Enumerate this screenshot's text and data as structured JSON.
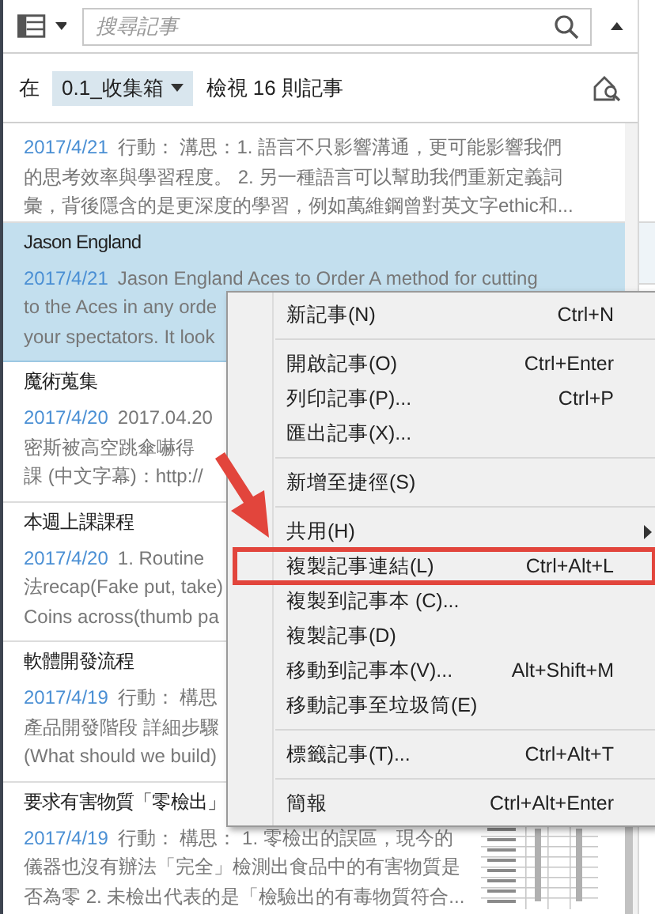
{
  "search": {
    "placeholder": "搜尋記事"
  },
  "filter": {
    "prefix": "在",
    "notebook": "0.1_收集箱",
    "count": "檢視 16 則記事"
  },
  "notes": [
    {
      "selected": false,
      "date": "2017/4/21",
      "lines": [
        "行動： 溝思：1. 語言不只影響溝通，更可能影響我們",
        "的思考效率與學習程度。 2. 另一種語言可以幫助我們重新定義詞",
        "彙，背後隱含的是更深度的學習，例如萬維鋼曾對英文字ethic和..."
      ]
    },
    {
      "selected": true,
      "title": "Jason England",
      "date": "2017/4/21",
      "lines": [
        "Jason England Aces to Order A method for cutting",
        "to the Aces in any orde",
        "your spectators. It look"
      ]
    },
    {
      "selected": false,
      "title": "魔術蒐集",
      "date": "2017/4/20",
      "lines": [
        "2017.04.20",
        "密斯被高空跳傘嚇得",
        "課 (中文字幕)：http://"
      ]
    },
    {
      "selected": false,
      "title": "本週上課課程",
      "date": "2017/4/20",
      "lines": [
        "1. Routine",
        "法recap(Fake put, take)",
        "Coins across(thumb pa"
      ]
    },
    {
      "selected": false,
      "title": "軟體開發流程",
      "date": "2017/4/19",
      "lines": [
        "行動： 構思",
        "產品開發階段 詳細步驟",
        "(What should we build)"
      ]
    },
    {
      "selected": false,
      "title": "要求有害物質「零檢出」",
      "date": "2017/4/19",
      "lines": [
        "行動： 構思： 1. 零檢出的誤區，現今的",
        "儀器也沒有辦法「完全」檢測出食品中的有害物質是",
        "否為零 2. 未檢出代表的是「檢驗出的有毒物質符合..."
      ]
    }
  ],
  "context_menu": {
    "items": [
      {
        "kind": "item",
        "label": "新記事(N)",
        "shortcut": "Ctrl+N",
        "submenu": false,
        "highlighted": false
      },
      {
        "kind": "separator"
      },
      {
        "kind": "item",
        "label": "開啟記事(O)",
        "shortcut": "Ctrl+Enter",
        "submenu": false,
        "highlighted": false
      },
      {
        "kind": "item",
        "label": "列印記事(P)...",
        "shortcut": "Ctrl+P",
        "submenu": false,
        "highlighted": false
      },
      {
        "kind": "item",
        "label": "匯出記事(X)...",
        "submenu": false,
        "highlighted": false
      },
      {
        "kind": "separator"
      },
      {
        "kind": "item",
        "label": "新增至捷徑(S)",
        "submenu": false,
        "highlighted": false
      },
      {
        "kind": "separator"
      },
      {
        "kind": "item",
        "label": "共用(H)",
        "submenu": true,
        "highlighted": false
      },
      {
        "kind": "item",
        "label": "複製記事連結(L)",
        "shortcut": "Ctrl+Alt+L",
        "submenu": false,
        "highlighted": true
      },
      {
        "kind": "item",
        "label": "複製到記事本 (C)...",
        "submenu": false,
        "highlighted": false
      },
      {
        "kind": "item",
        "label": "複製記事(D)",
        "submenu": false,
        "highlighted": false
      },
      {
        "kind": "item",
        "label": "移動到記事本(V)...",
        "shortcut": "Alt+Shift+M",
        "submenu": false,
        "highlighted": false
      },
      {
        "kind": "item",
        "label": "移動記事至垃圾筒(E)",
        "submenu": false,
        "highlighted": false
      },
      {
        "kind": "separator"
      },
      {
        "kind": "item",
        "label": "標籤記事(T)...",
        "shortcut": "Ctrl+Alt+T",
        "submenu": false,
        "highlighted": false
      },
      {
        "kind": "separator"
      },
      {
        "kind": "item",
        "label": "簡報",
        "shortcut": "Ctrl+Alt+Enter",
        "submenu": false,
        "highlighted": false
      }
    ]
  }
}
